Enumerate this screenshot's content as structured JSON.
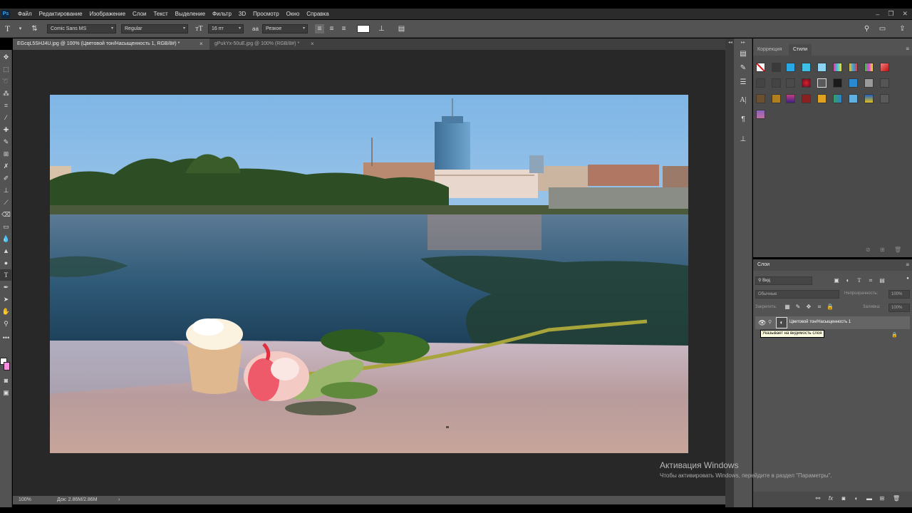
{
  "app": {
    "logo_text": "Ps"
  },
  "menu": [
    "Файл",
    "Редактирование",
    "Изображение",
    "Слои",
    "Текст",
    "Выделение",
    "Фильтр",
    "3D",
    "Просмотр",
    "Окно",
    "Справка"
  ],
  "window_controls": [
    "–",
    "❐",
    "✕"
  ],
  "options_bar": {
    "font_family": "Comic Sans MS",
    "font_style": "Regular",
    "font_size": "16 пт",
    "antialias": "Резкое"
  },
  "tabs": [
    {
      "label": "EGcqL5SHJ4U.jpg @ 100% (Цветовой тон/Насыщенность 1, RGB/8#) *",
      "active": true
    },
    {
      "label": "gPukYx-50uE.jpg @ 100% (RGB/8#) *",
      "active": false
    }
  ],
  "status": {
    "zoom": "100%",
    "doc": "Док: 2.86M/2.86M",
    "arrow": "›"
  },
  "styles_panel": {
    "tab_correction": "Коррекция",
    "tab_styles": "Стили"
  },
  "layers_panel": {
    "title": "Слои",
    "filter_kind": "Вид",
    "blend_mode": "Обычные",
    "opacity_label": "Непрозрачность:",
    "opacity_value": "100%",
    "lock_label": "Закрепить:",
    "fill_label": "Заливка:",
    "fill_value": "100%",
    "layer_name": "Цветовой тон/Насыщенность 1",
    "tooltip": "Указывает на видимость слоя"
  },
  "watermark": {
    "title": "Активация Windows",
    "subtitle": "Чтобы активировать Windows, перейдите в раздел \"Параметры\"."
  },
  "colors": {
    "app_bg": "#535353",
    "canvas_bg": "#282828",
    "swatch_fg": "#ffffff",
    "swatch_bg": "#f78fe0"
  }
}
